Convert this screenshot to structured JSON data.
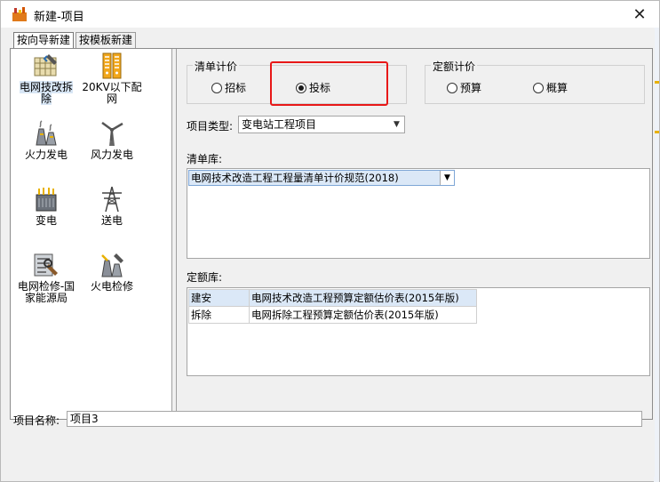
{
  "window": {
    "title": "新建-项目",
    "close_glyph": "✕"
  },
  "tabs": [
    {
      "label": "按向导新建",
      "active": true
    },
    {
      "label": "按模板新建",
      "active": false
    }
  ],
  "categories": [
    {
      "label": "电网技改拆除",
      "icon": "grid-refurbish-icon",
      "selected": true
    },
    {
      "label": "20KV以下配网",
      "icon": "distribution-cabinet-icon",
      "selected": false
    },
    {
      "label": "火力发电",
      "icon": "thermal-power-icon",
      "selected": false
    },
    {
      "label": "风力发电",
      "icon": "wind-turbine-icon",
      "selected": false
    },
    {
      "label": "变电",
      "icon": "transformer-icon",
      "selected": false
    },
    {
      "label": "送电",
      "icon": "transmission-tower-icon",
      "selected": false
    },
    {
      "label": "电网检修-国家能源局",
      "icon": "grid-maintenance-icon",
      "selected": false
    },
    {
      "label": "火电检修",
      "icon": "thermal-maintenance-icon",
      "selected": false
    }
  ],
  "bill_pricing": {
    "legend": "清单计价",
    "options": [
      {
        "label": "招标",
        "checked": false
      },
      {
        "label": "投标",
        "checked": true
      }
    ]
  },
  "quota_pricing": {
    "legend": "定额计价",
    "options": [
      {
        "label": "预算",
        "checked": false
      },
      {
        "label": "概算",
        "checked": false
      }
    ]
  },
  "project_type": {
    "label": "项目类型:",
    "value": "变电站工程项目"
  },
  "bill_library": {
    "label": "清单库:",
    "value": "电网技术改造工程工程量清单计价规范(2018)"
  },
  "quota_library": {
    "label": "定额库:",
    "rows": [
      {
        "type": "建安",
        "name": "电网技术改造工程预算定额估价表(2015年版)"
      },
      {
        "type": "拆除",
        "name": "电网拆除工程预算定额估价表(2015年版)"
      }
    ]
  },
  "project_name": {
    "label": "项目名称:",
    "value": "项目3"
  },
  "colors": {
    "accent_red": "#e81818",
    "selection_blue": "#dbe8f7",
    "tick_yellow": "#e8b100"
  }
}
